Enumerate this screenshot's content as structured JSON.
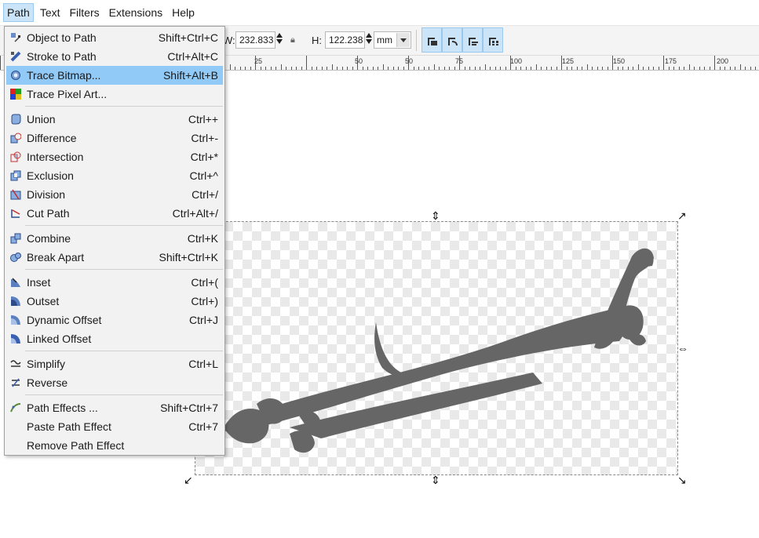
{
  "menubar": {
    "items": [
      {
        "label": "Path",
        "active": true
      },
      {
        "label": "Text"
      },
      {
        "label": "Filters"
      },
      {
        "label": "Extensions"
      },
      {
        "label": "Help"
      }
    ]
  },
  "toolbar": {
    "w_label": "W:",
    "w_value": "232.833",
    "h_label": "H:",
    "h_value": "122.238",
    "unit": "mm"
  },
  "ruler": {
    "ticks": [
      "25",
      "50",
      "75",
      "100",
      "125",
      "150",
      "175",
      "200"
    ]
  },
  "path_menu": {
    "items": [
      {
        "label": "Object to Path",
        "shortcut": "Shift+Ctrl+C",
        "icon": "object-to-path-icon"
      },
      {
        "label": "Stroke to Path",
        "shortcut": "Ctrl+Alt+C",
        "icon": "stroke-to-path-icon"
      },
      {
        "label": "Trace Bitmap...",
        "shortcut": "Shift+Alt+B",
        "icon": "trace-bitmap-icon",
        "highlighted": true
      },
      {
        "label": "Trace Pixel Art...",
        "shortcut": "",
        "icon": "trace-pixel-art-icon"
      },
      {
        "label": "Union",
        "shortcut": "Ctrl++",
        "icon": "union-icon"
      },
      {
        "label": "Difference",
        "shortcut": "Ctrl+-",
        "icon": "difference-icon"
      },
      {
        "label": "Intersection",
        "shortcut": "Ctrl+*",
        "icon": "intersection-icon"
      },
      {
        "label": "Exclusion",
        "shortcut": "Ctrl+^",
        "icon": "exclusion-icon"
      },
      {
        "label": "Division",
        "shortcut": "Ctrl+/",
        "icon": "division-icon"
      },
      {
        "label": "Cut Path",
        "shortcut": "Ctrl+Alt+/",
        "icon": "cut-path-icon"
      },
      {
        "label": "Combine",
        "shortcut": "Ctrl+K",
        "icon": "combine-icon"
      },
      {
        "label": "Break Apart",
        "shortcut": "Shift+Ctrl+K",
        "icon": "break-apart-icon"
      },
      {
        "label": "Inset",
        "shortcut": "Ctrl+(",
        "icon": "inset-icon"
      },
      {
        "label": "Outset",
        "shortcut": "Ctrl+)",
        "icon": "outset-icon"
      },
      {
        "label": "Dynamic Offset",
        "shortcut": "Ctrl+J",
        "icon": "dynamic-offset-icon"
      },
      {
        "label": "Linked Offset",
        "shortcut": "",
        "icon": "linked-offset-icon"
      },
      {
        "label": "Simplify",
        "shortcut": "Ctrl+L",
        "icon": "simplify-icon"
      },
      {
        "label": "Reverse",
        "shortcut": "",
        "icon": "reverse-icon"
      },
      {
        "label": "Path Effects ...",
        "shortcut": "Shift+Ctrl+7",
        "icon": "path-effects-icon"
      },
      {
        "label": "Paste Path Effect",
        "shortcut": "Ctrl+7",
        "icon": ""
      },
      {
        "label": "Remove Path Effect",
        "shortcut": "",
        "icon": ""
      }
    ]
  },
  "colors": {
    "menu_highlight": "#91c9f7",
    "toolbar_toggle": "#cce4f7",
    "calligraphy": "#666666"
  }
}
